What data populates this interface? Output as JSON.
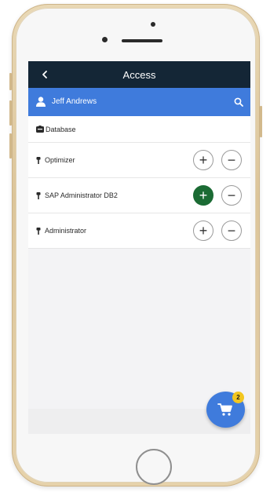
{
  "header": {
    "title": "Access",
    "back_icon": "chevron-left-icon"
  },
  "user": {
    "name": "Jeff Andrews",
    "icon": "user-icon",
    "search_icon": "search-icon"
  },
  "database": {
    "label": "Database",
    "icon": "database-icon"
  },
  "roles": [
    {
      "label": "Optimizer",
      "icon": "key-icon",
      "add_active": false
    },
    {
      "label": "SAP Administrator DB2",
      "icon": "key-icon",
      "add_active": true
    },
    {
      "label": "Administrator",
      "icon": "key-icon",
      "add_active": false
    }
  ],
  "buttons": {
    "add_symbol": "+",
    "remove_symbol": "−"
  },
  "cart": {
    "icon": "cart-icon",
    "count": "2"
  },
  "colors": {
    "navbar": "#142636",
    "userbar": "#3f7bdc",
    "active_add": "#1b6b34",
    "badge": "#f2c61f"
  }
}
